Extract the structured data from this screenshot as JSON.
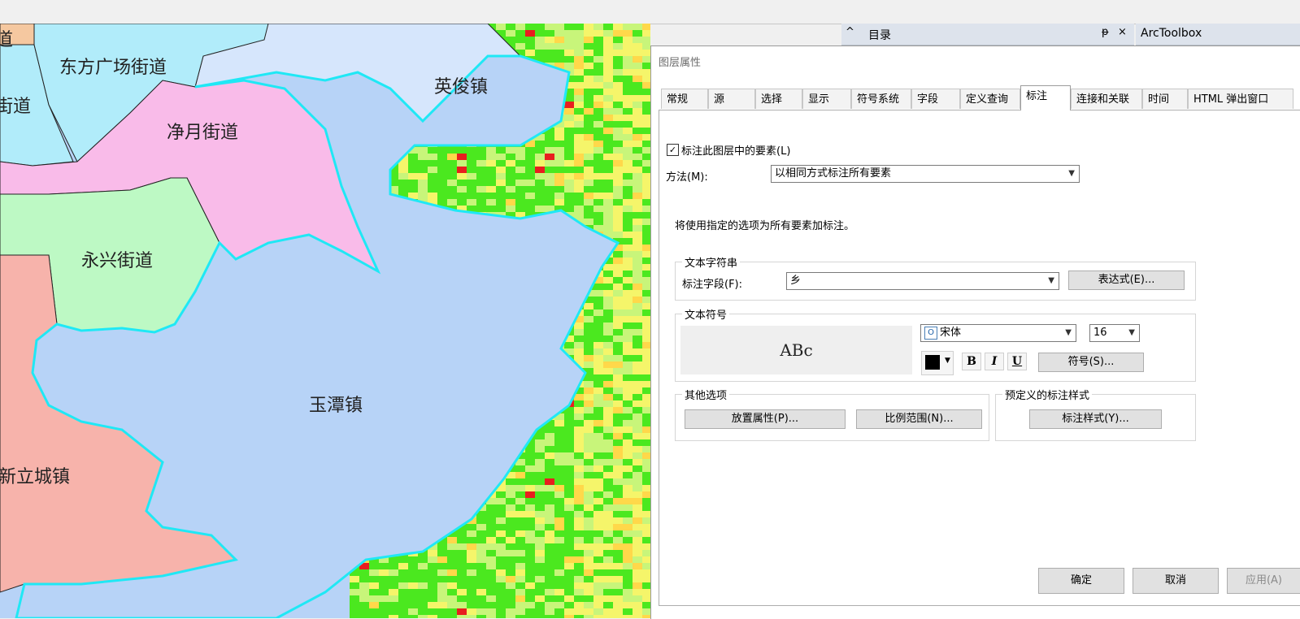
{
  "map": {
    "places": [
      "道",
      "东方广场街道",
      "街道",
      "净月街道",
      "英俊镇",
      "永兴街道",
      "玉潭镇",
      "新立城镇"
    ],
    "colors": {
      "water": "#b7d3f7",
      "outline": "#1fe8f5",
      "lightblue": "#b1ecfa",
      "pink": "#f9bbe9",
      "green": "#bdf9c4",
      "salmon": "#f7b3ab",
      "paleblue": "#d6e6fc",
      "tan": "#f5c8a0"
    }
  },
  "panes": {
    "catalog_title": "目录",
    "arctoolbox_title": "ArcToolbox",
    "collapse_icon": "^",
    "pin_icon": "ᵽ",
    "close_icon": "×"
  },
  "dialog": {
    "title": "图层属性",
    "tabs": [
      "常规",
      "源",
      "选择",
      "显示",
      "符号系统",
      "字段",
      "定义查询",
      "标注",
      "连接和关联",
      "时间",
      "HTML 弹出窗口"
    ],
    "active_tab": "标注",
    "label_checkbox": {
      "checked": true,
      "mark": "✓",
      "label": "标注此图层中的要素(L)"
    },
    "method": {
      "label": "方法(M):",
      "value": "以相同方式标注所有要素"
    },
    "info": "将使用指定的选项为所有要素加标注。",
    "text_string": {
      "group": "文本字符串",
      "field_label": "标注字段(F):",
      "field_value": "乡",
      "expression_button": "表达式(E)..."
    },
    "text_symbol": {
      "group": "文本符号",
      "preview": "ABc",
      "font": "宋体",
      "font_icon": "O",
      "size": "16",
      "bold": "B",
      "italic": "I",
      "underline": "U",
      "symbol_button": "符号(S)...",
      "color": "#000000"
    },
    "other": {
      "group": "其他选项",
      "placement_button": "放置属性(P)...",
      "scale_button": "比例范围(N)..."
    },
    "predefined": {
      "group": "预定义的标注样式",
      "style_button": "标注样式(Y)..."
    },
    "footer": {
      "ok": "确定",
      "cancel": "取消",
      "apply": "应用(A)"
    }
  }
}
